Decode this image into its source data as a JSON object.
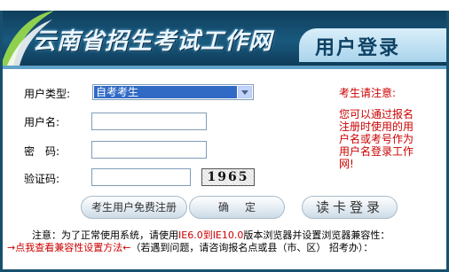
{
  "banner": {
    "title": "云南省招生考试工作网",
    "subtitle": "用户登录"
  },
  "form": {
    "user_type_label": "用户类型:",
    "user_type_value": "自考考生",
    "username_label": "用户名:",
    "password_label": "密　码:",
    "captcha_label": "验证码:",
    "captcha_text": "1965"
  },
  "notice": {
    "title": "考生请注意:",
    "body": "您可以通过报名注册时使用的用户名或考号作为用户名登录工作网!"
  },
  "buttons": {
    "register": "考生用户免费注册",
    "confirm": "确定",
    "read_card": "读卡登录"
  },
  "footer": {
    "line1_prefix": "注意：为了正常使用系统，请使用",
    "line1_red": "IE6.0到IE10.0",
    "line1_suffix": "版本浏览器并设置浏览器兼容性：",
    "line2_red": "→点我查看兼容性设置方法←",
    "line2_suffix": "（若遇到问题，请咨询报名点或县（市、区） 招考办）："
  },
  "colors": {
    "banner_dark": "#0f3e5c",
    "border": "#17506f",
    "select_highlight": "#316ac5",
    "notice_red": "#cc0000"
  }
}
